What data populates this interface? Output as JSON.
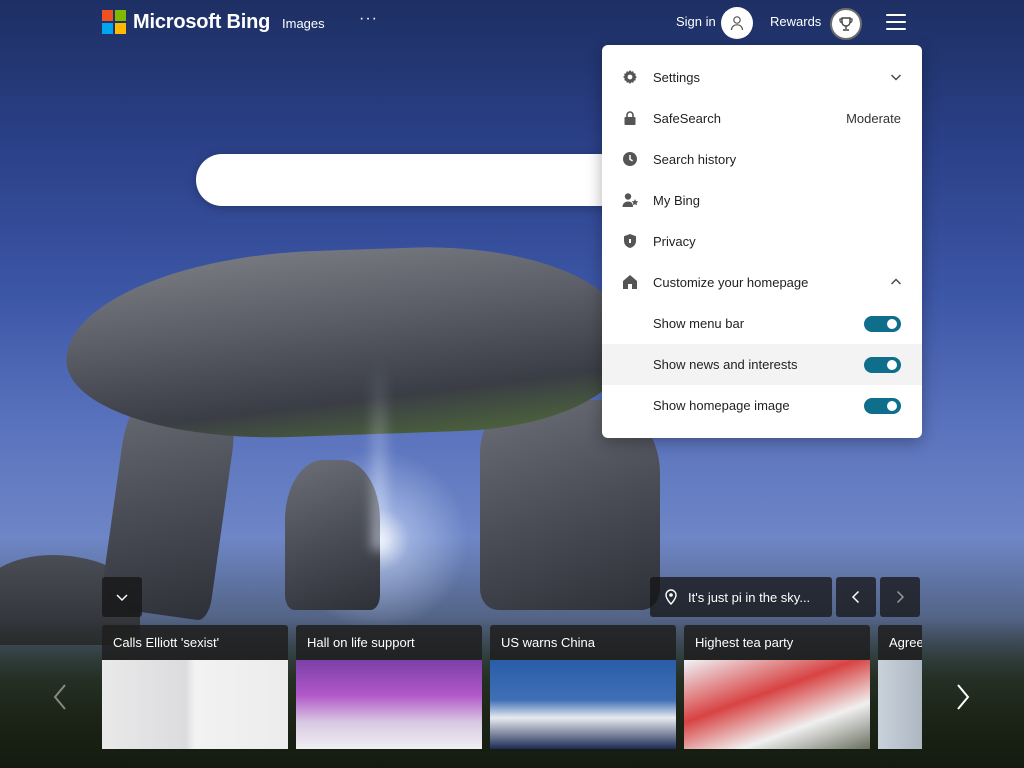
{
  "header": {
    "brand": "Microsoft Bing",
    "nav_images": "Images",
    "nav_more": "···",
    "signin_label": "Sign in",
    "rewards_label": "Rewards"
  },
  "search": {
    "placeholder": ""
  },
  "menu": {
    "items": [
      {
        "label": "Settings",
        "icon": "gear-icon"
      },
      {
        "label": "SafeSearch",
        "value": "Moderate",
        "icon": "lock-icon"
      },
      {
        "label": "Search history",
        "icon": "clock-icon"
      },
      {
        "label": "My Bing",
        "icon": "person-star-icon"
      },
      {
        "label": "Privacy",
        "icon": "shield-icon"
      },
      {
        "label": "Customize your homepage",
        "icon": "home-icon"
      }
    ],
    "customize": [
      {
        "label": "Show menu bar",
        "enabled": true
      },
      {
        "label": "Show news and interests",
        "enabled": true
      },
      {
        "label": "Show homepage image",
        "enabled": true
      }
    ]
  },
  "image_caption": "It's just pi in the sky...",
  "news": [
    {
      "title": "Calls Elliott 'sexist'"
    },
    {
      "title": "Hall on life support"
    },
    {
      "title": "US warns China"
    },
    {
      "title": "Highest tea party"
    },
    {
      "title": "Agree"
    }
  ]
}
